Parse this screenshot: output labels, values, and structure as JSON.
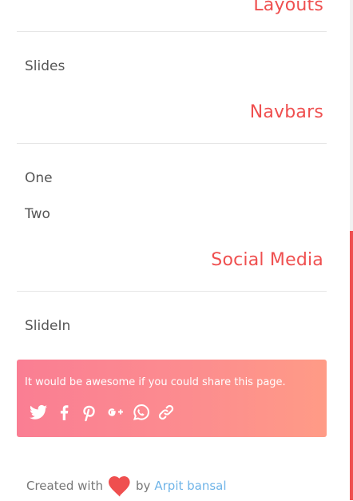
{
  "sections": [
    {
      "title": "Layouts",
      "items": [
        "Slides"
      ]
    },
    {
      "title": "Navbars",
      "items": [
        "One",
        "Two"
      ]
    },
    {
      "title": "Social Media",
      "items": [
        "SlideIn"
      ]
    }
  ],
  "share": {
    "text": "It would be awesome if you could share this page.",
    "icons": [
      "twitter-icon",
      "facebook-icon",
      "pinterest-icon",
      "google-plus-icon",
      "whatsapp-icon",
      "link-icon"
    ]
  },
  "footer": {
    "created_with": "Created with",
    "by": "by",
    "author": "Arpit bansal"
  },
  "colors": {
    "accent": "#ef4f4f",
    "link": "#6fb4e8",
    "share_gradient_start": "#fa7e93",
    "share_gradient_end": "#ff9b86"
  }
}
